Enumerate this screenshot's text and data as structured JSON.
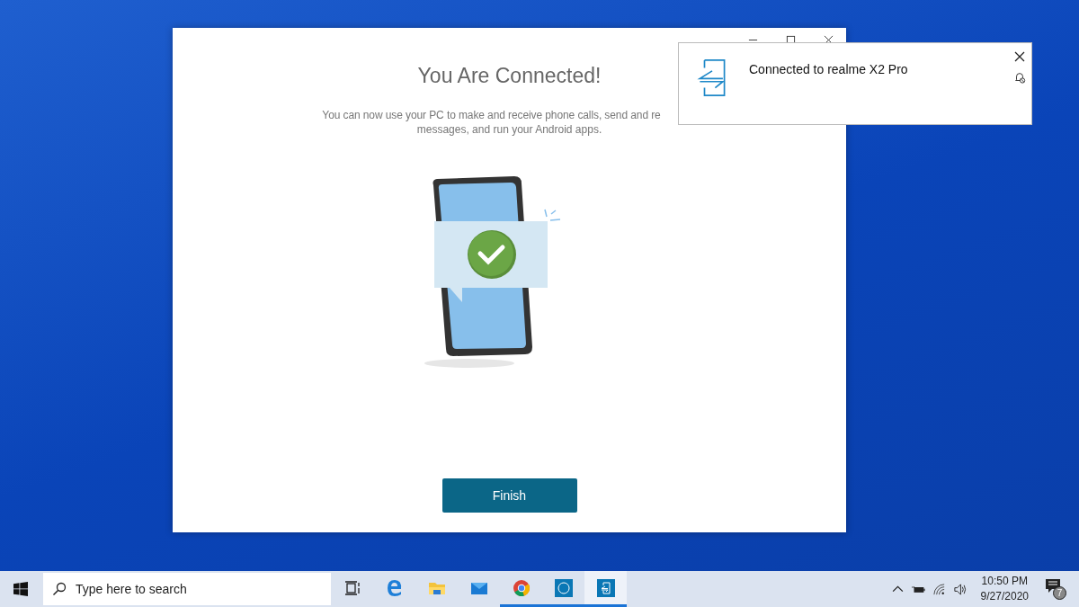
{
  "window": {
    "controls": [
      {
        "kind": "minimize"
      },
      {
        "kind": "maximize"
      },
      {
        "kind": "close"
      }
    ],
    "title": "You Are Connected!",
    "description_lines": [
      "You can now use your PC to make and receive phone calls, send and re",
      "messages, and run your Android apps."
    ],
    "button": "Finish"
  },
  "notification": {
    "message": "Connected to realme X2 Pro"
  },
  "taskbar": {
    "search": {
      "placeholder": "Type here to search"
    },
    "apps": [
      {
        "kind": "taskview",
        "running": false,
        "selected": false
      },
      {
        "kind": "edge",
        "running": false,
        "selected": false
      },
      {
        "kind": "explorer",
        "running": false,
        "selected": false
      },
      {
        "kind": "mail",
        "running": false,
        "selected": false
      },
      {
        "kind": "chrome",
        "running": true,
        "selected": false
      },
      {
        "kind": "dell",
        "running": true,
        "selected": false
      },
      {
        "kind": "phone",
        "running": true,
        "selected": true
      }
    ],
    "time": "10:50 PM",
    "date": "9/27/2020",
    "notification_count": "7"
  }
}
